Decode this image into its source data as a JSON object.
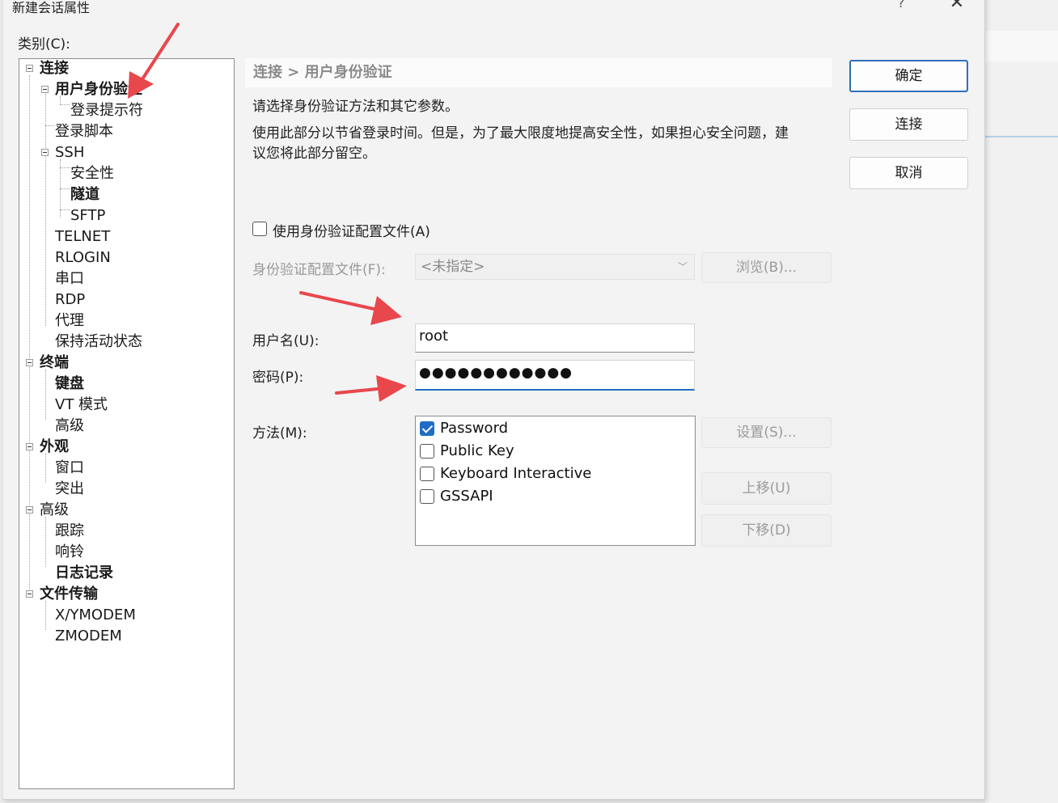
{
  "window": {
    "title": "新建会话属性",
    "help_glyph": "?",
    "close_glyph": "✕"
  },
  "category_label": "类别(C):",
  "tree": [
    {
      "label": "连接",
      "bold": true
    },
    {
      "label": "用户身份验证",
      "bold": true
    },
    {
      "label": "登录提示符",
      "bold": false
    },
    {
      "label": "登录脚本",
      "bold": false
    },
    {
      "label": "SSH",
      "bold": false
    },
    {
      "label": "安全性",
      "bold": false
    },
    {
      "label": "隧道",
      "bold": true
    },
    {
      "label": "SFTP",
      "bold": false
    },
    {
      "label": "TELNET",
      "bold": false
    },
    {
      "label": "RLOGIN",
      "bold": false
    },
    {
      "label": "串口",
      "bold": false
    },
    {
      "label": "RDP",
      "bold": false
    },
    {
      "label": "代理",
      "bold": false
    },
    {
      "label": "保持活动状态",
      "bold": false
    },
    {
      "label": "终端",
      "bold": true
    },
    {
      "label": "键盘",
      "bold": true
    },
    {
      "label": "VT 模式",
      "bold": false
    },
    {
      "label": "高级",
      "bold": false
    },
    {
      "label": "外观",
      "bold": true
    },
    {
      "label": "窗口",
      "bold": false
    },
    {
      "label": "突出",
      "bold": false
    },
    {
      "label": "高级",
      "bold": false
    },
    {
      "label": "跟踪",
      "bold": false
    },
    {
      "label": "响铃",
      "bold": false
    },
    {
      "label": "日志记录",
      "bold": true
    },
    {
      "label": "文件传输",
      "bold": true
    },
    {
      "label": "X/YMODEM",
      "bold": false
    },
    {
      "label": "ZMODEM",
      "bold": false
    }
  ],
  "breadcrumb": "连接 > 用户身份验证",
  "description": {
    "line1": "请选择身份验证方法和其它参数。",
    "line2": "使用此部分以节省登录时间。但是，为了最大限度地提高安全性，如果担心安全问题，建",
    "line3": "议您将此部分留空。"
  },
  "auth_profile": {
    "checkbox_label": "使用身份验证配置文件(A)",
    "checked": false,
    "file_label": "身份验证配置文件(F):",
    "file_value": "<未指定>",
    "browse_button": "浏览(B)..."
  },
  "username": {
    "label": "用户名(U):",
    "value": "root"
  },
  "password": {
    "label": "密码(P):",
    "value": "●●●●●●●●●●●●"
  },
  "method": {
    "label": "方法(M):",
    "items": [
      {
        "label": "Password",
        "checked": true
      },
      {
        "label": "Public Key",
        "checked": false
      },
      {
        "label": "Keyboard Interactive",
        "checked": false
      },
      {
        "label": "GSSAPI",
        "checked": false
      }
    ],
    "settings_button": "设置(S)...",
    "move_up_button": "上移(U)",
    "move_down_button": "下移(D)"
  },
  "buttons": {
    "ok": "确定",
    "connect": "连接",
    "cancel": "取消"
  },
  "colors": {
    "accent": "#1f6dc4",
    "annotation_arrow": "#e8474c"
  }
}
